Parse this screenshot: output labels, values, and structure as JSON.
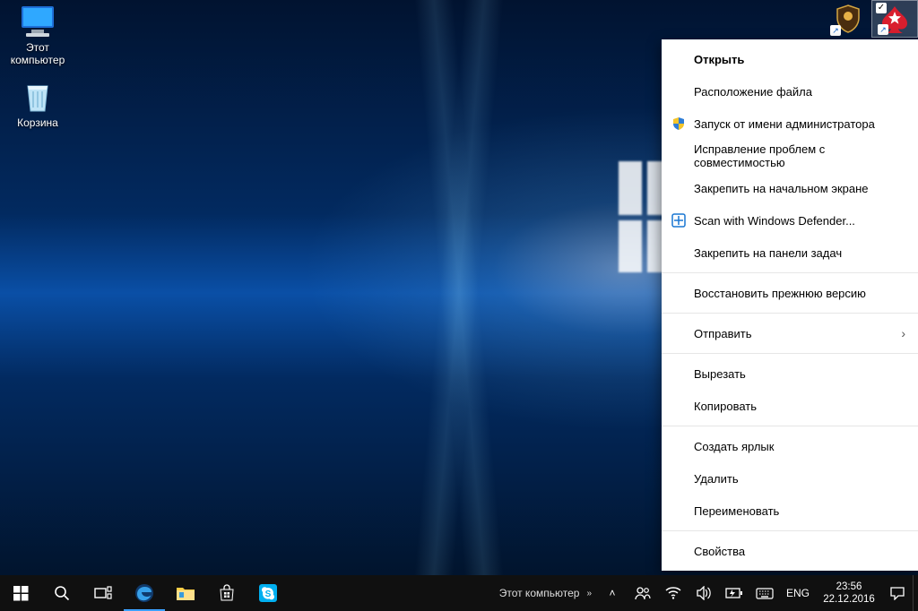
{
  "desktop_icons": [
    {
      "name": "this-pc",
      "label": "Этот\nкомпьютер"
    },
    {
      "name": "recycle-bin",
      "label": "Корзина"
    }
  ],
  "topright_shortcuts": [
    {
      "name": "shield-shortcut"
    },
    {
      "name": "pokerstars-shortcut"
    }
  ],
  "context_menu": {
    "open": "Открыть",
    "file_location": "Расположение файла",
    "run_admin": "Запуск от имени администратора",
    "compat": "Исправление проблем с совместимостью",
    "pin_start": "Закрепить на начальном экране",
    "defender": "Scan with Windows Defender...",
    "pin_taskbar": "Закрепить на панели задач",
    "restore_prev": "Восстановить прежнюю версию",
    "send_to": "Отправить",
    "cut": "Вырезать",
    "copy": "Копировать",
    "create_shortcut": "Создать ярлык",
    "delete": "Удалить",
    "rename": "Переименовать",
    "properties": "Свойства"
  },
  "taskbar": {
    "active_window": "Этот компьютер",
    "lang": "ENG",
    "time": "23:56",
    "date": "22.12.2016"
  }
}
